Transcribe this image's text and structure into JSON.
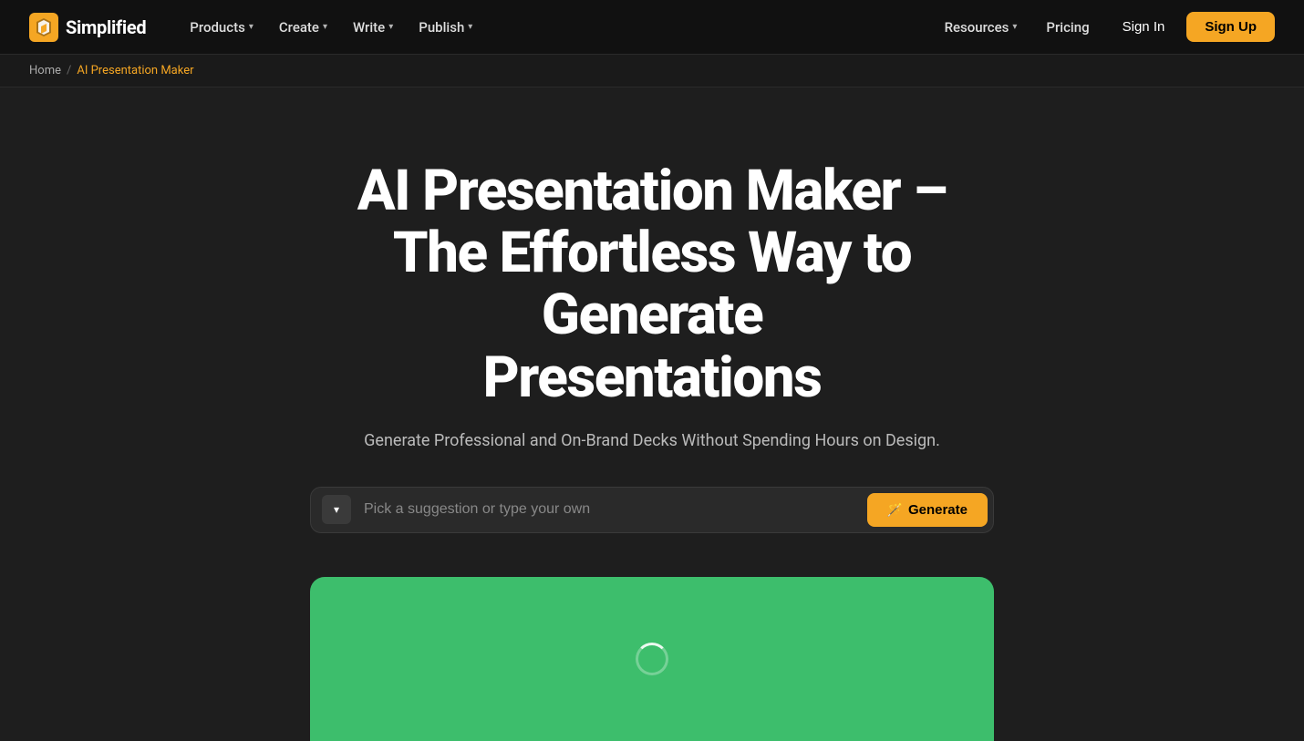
{
  "brand": {
    "name": "Simplified",
    "logo_alt": "Simplified logo"
  },
  "nav": {
    "links_left": [
      {
        "id": "products",
        "label": "Products",
        "has_dropdown": true
      },
      {
        "id": "create",
        "label": "Create",
        "has_dropdown": true
      },
      {
        "id": "write",
        "label": "Write",
        "has_dropdown": true
      },
      {
        "id": "publish",
        "label": "Publish",
        "has_dropdown": true
      }
    ],
    "links_right": [
      {
        "id": "resources",
        "label": "Resources",
        "has_dropdown": true
      },
      {
        "id": "pricing",
        "label": "Pricing",
        "has_dropdown": false
      },
      {
        "id": "signin",
        "label": "Sign In",
        "has_dropdown": false
      },
      {
        "id": "signup",
        "label": "Sign Up",
        "has_dropdown": false
      }
    ],
    "sign_in_label": "Sign In",
    "sign_up_label": "Sign Up"
  },
  "breadcrumb": {
    "home_label": "Home",
    "separator": "/",
    "current_label": "AI Presentation Maker"
  },
  "hero": {
    "title_line1": "AI Presentation Maker –",
    "title_line2": "The Effortless Way to Generate",
    "title_line3": "Presentations",
    "subtitle": "Generate Professional and On-Brand Decks Without Spending Hours on Design.",
    "input_placeholder": "Pick a suggestion or type your own",
    "generate_button_label": "Generate",
    "generate_icon": "🪄"
  },
  "colors": {
    "accent": "#f5a623",
    "preview_bg": "#3dbe6c",
    "nav_bg": "#111111",
    "page_bg": "#1e1e1e"
  }
}
